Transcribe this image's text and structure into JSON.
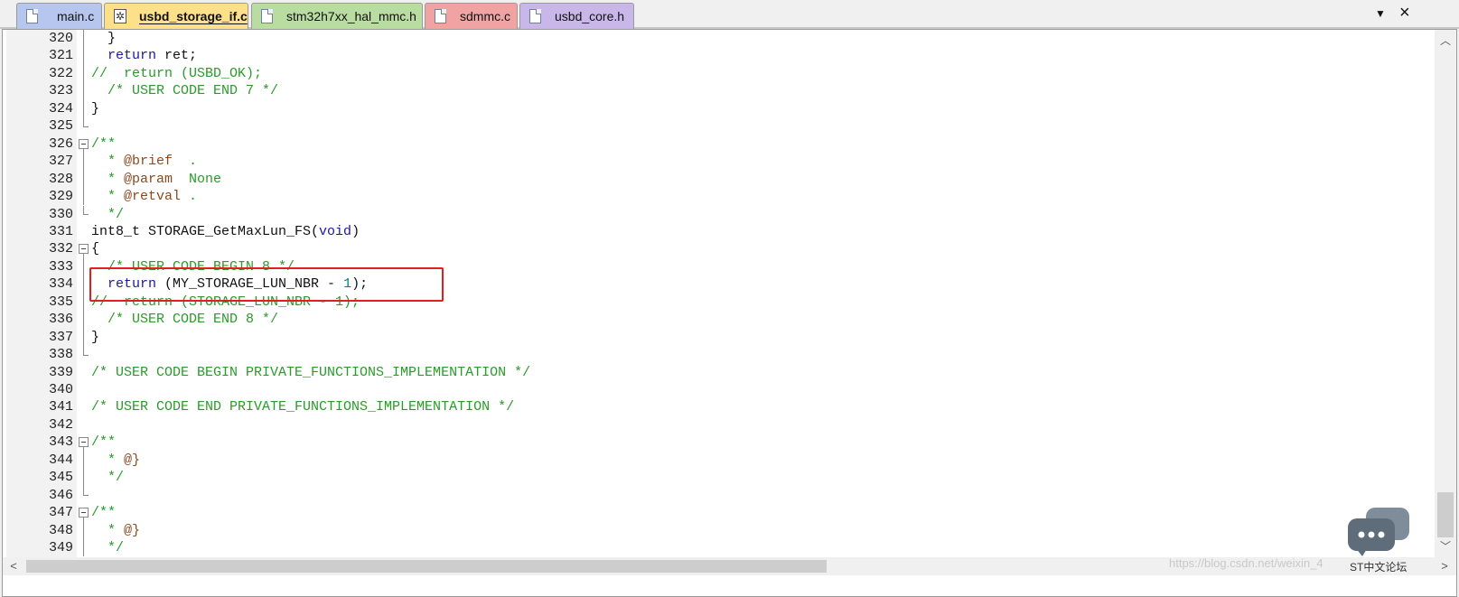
{
  "tabs": [
    {
      "label": "main.c",
      "color": "#b7c6ee",
      "active": false,
      "icon": "document-icon"
    },
    {
      "label": "usbd_storage_if.c",
      "color": "#ffe08a",
      "active": true,
      "icon": "modified-document-icon"
    },
    {
      "label": "stm32h7xx_hal_mmc.h",
      "color": "#b9dca0",
      "active": false,
      "icon": "document-icon"
    },
    {
      "label": "sdmmc.c",
      "color": "#f1a3a3",
      "active": false,
      "icon": "document-icon"
    },
    {
      "label": "usbd_core.h",
      "color": "#c9b7ea",
      "active": false,
      "icon": "document-icon"
    }
  ],
  "tab_menu_glyph": "▼",
  "close_glyph": "×",
  "gear_glyph": "✲",
  "lines": [
    {
      "no": "320",
      "code": "  }",
      "fold": "line"
    },
    {
      "no": "321",
      "code": "  return ret;",
      "fold": "line"
    },
    {
      "no": "322",
      "code": "//  return (USBD_OK);",
      "fold": "line"
    },
    {
      "no": "323",
      "code": "  /* USER CODE END 7 */",
      "fold": "line"
    },
    {
      "no": "324",
      "code": "}",
      "fold": "line"
    },
    {
      "no": "325",
      "code": "",
      "fold": "end"
    },
    {
      "no": "326",
      "code": "/**",
      "fold": "box"
    },
    {
      "no": "327",
      "code": "  * @brief  .",
      "fold": "line"
    },
    {
      "no": "328",
      "code": "  * @param  None",
      "fold": "line"
    },
    {
      "no": "329",
      "code": "  * @retval .",
      "fold": "line"
    },
    {
      "no": "330",
      "code": "  */",
      "fold": "end"
    },
    {
      "no": "331",
      "code": "int8_t STORAGE_GetMaxLun_FS(void)",
      "fold": "none"
    },
    {
      "no": "332",
      "code": "{",
      "fold": "box"
    },
    {
      "no": "333",
      "code": "  /* USER CODE BEGIN 8 */",
      "fold": "line"
    },
    {
      "no": "334",
      "code": "  return (MY_STORAGE_LUN_NBR - 1);",
      "fold": "line"
    },
    {
      "no": "335",
      "code": "//  return (STORAGE_LUN_NBR - 1);",
      "fold": "line"
    },
    {
      "no": "336",
      "code": "  /* USER CODE END 8 */",
      "fold": "line"
    },
    {
      "no": "337",
      "code": "}",
      "fold": "line"
    },
    {
      "no": "338",
      "code": "",
      "fold": "end"
    },
    {
      "no": "339",
      "code": "/* USER CODE BEGIN PRIVATE_FUNCTIONS_IMPLEMENTATION */",
      "fold": "none"
    },
    {
      "no": "340",
      "code": "",
      "fold": "none"
    },
    {
      "no": "341",
      "code": "/* USER CODE END PRIVATE_FUNCTIONS_IMPLEMENTATION */",
      "fold": "none"
    },
    {
      "no": "342",
      "code": "",
      "fold": "none"
    },
    {
      "no": "343",
      "code": "/**",
      "fold": "box"
    },
    {
      "no": "344",
      "code": "  * @}",
      "fold": "line"
    },
    {
      "no": "345",
      "code": "  */",
      "fold": "line"
    },
    {
      "no": "346",
      "code": "",
      "fold": "end"
    },
    {
      "no": "347",
      "code": "/**",
      "fold": "box"
    },
    {
      "no": "348",
      "code": "  * @}",
      "fold": "line"
    },
    {
      "no": "349",
      "code": "  */",
      "fold": "line"
    }
  ],
  "highlighted_line": "334",
  "highlight_color": "#e02020",
  "scroll_up_glyph": "︿",
  "scroll_down_glyph": "﹀",
  "scroll_left_glyph": "<",
  "scroll_right_glyph": ">",
  "watermark": "https://blog.csdn.net/weixin_4",
  "forum_label": "ST中文论坛"
}
